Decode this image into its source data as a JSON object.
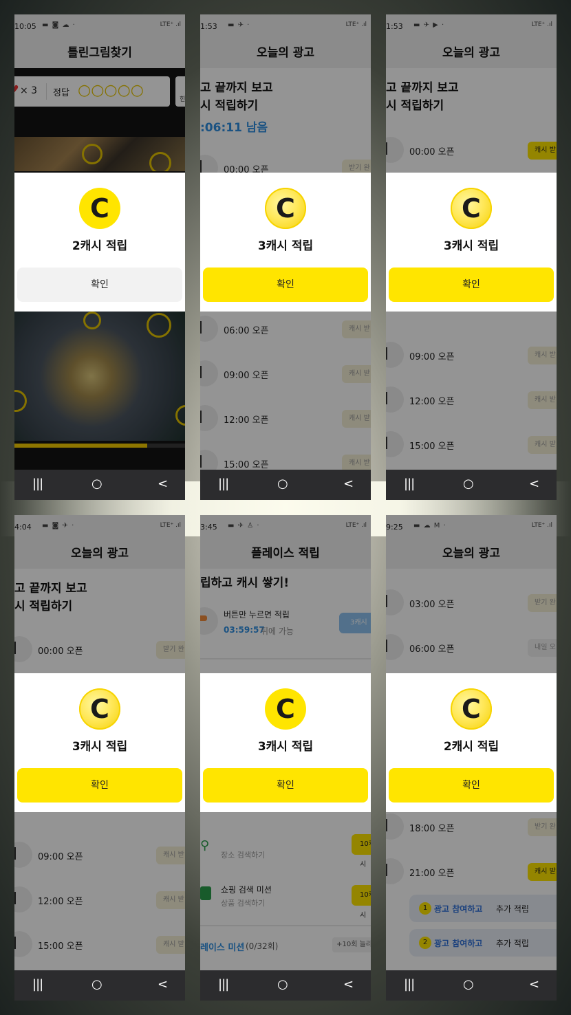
{
  "common": {
    "confirm_label": "확인",
    "nav": {
      "recent": "|||",
      "home": "○",
      "back": "<"
    },
    "coin_letter": "C",
    "open_suffix": "오픈"
  },
  "panels": [
    {
      "time": "10:05",
      "status_icons": "▬ ◙ ☁ ·",
      "network": "LTE⁺ .ıl",
      "title": "틀린그림찾기",
      "lives": "× 3",
      "answer_label": "정답",
      "hint": "힌",
      "reward_title": "2캐시 적립"
    },
    {
      "time": "1:53",
      "status_icons": "▬ ✈ ·",
      "network": "LTE⁺ .ıl",
      "title": "오늘의 광고",
      "headline1": "고 끝까지 보고",
      "headline2": "시 적립하기",
      "countdown": ":06:11 남음",
      "slots": [
        {
          "time": "00:00",
          "badge": "받기 완"
        },
        {
          "time": "06:00",
          "badge": "캐시 받"
        },
        {
          "time": "09:00",
          "badge": "캐시 받"
        },
        {
          "time": "12:00",
          "badge": "캐시 받"
        },
        {
          "time": "15:00",
          "badge": "캐시 받"
        }
      ],
      "reward_title": "3캐시 적립"
    },
    {
      "time": "1:53",
      "status_icons": "▬ ✈ ▶ ·",
      "network": "LTE⁺ .ıl",
      "title": "오늘의 광고",
      "headline1": "고 끝까지 보고",
      "headline2": "시 적립하기",
      "slots": [
        {
          "time": "00:00",
          "badge": "캐시 받"
        },
        {
          "time": "09:00",
          "badge": "캐시 받"
        },
        {
          "time": "12:00",
          "badge": "캐시 받"
        },
        {
          "time": "15:00",
          "badge": "캐시 받"
        }
      ],
      "reward_title": "3캐시 적립"
    },
    {
      "time": "4:04",
      "status_icons": "▬ ◙ ✈ ·",
      "network": "LTE⁺ .ıl",
      "title": "오늘의 광고",
      "headline1": "고 끝까지 보고",
      "headline2": "시 적립하기",
      "slots": [
        {
          "time": "00:00",
          "badge": "받기 완"
        },
        {
          "time": "09:00",
          "badge": "캐시 받"
        },
        {
          "time": "12:00",
          "badge": "캐시 받"
        },
        {
          "time": "15:00",
          "badge": "캐시 받"
        }
      ],
      "reward_title": "3캐시 적립"
    },
    {
      "time": "3:45",
      "status_icons": "▬ ✈ ♙ ·",
      "network": "LTE⁺ .ıl",
      "title": "플레이스 적립",
      "headline1": "립하고 캐시 쌓기!",
      "press_title": "버튼만 누르면 적립",
      "press_timer": "03:59:57",
      "press_suffix": " 뒤에 가능",
      "press_badge": "3캐시",
      "place_sub": "장소 검색하기",
      "place_badge": "10캐시",
      "shop_title": "쇼핑 검색 미션",
      "shop_sub": "상품 검색하기",
      "shop_badge": "10캐시",
      "mission_title": "레이스 미션",
      "mission_count": "(0/32회)",
      "mission_more": "+10회 늘리",
      "reward_title": "3캐시 적립"
    },
    {
      "time": "9:25",
      "status_icons": "▬ ☁ M ·",
      "network": "LTE⁺ .ıl",
      "title": "오늘의 광고",
      "slots_top": [
        {
          "time": "03:00",
          "badge": "받기 완"
        },
        {
          "time": "06:00",
          "badge": "내일 오"
        }
      ],
      "slots_bottom": [
        {
          "time": "18:00",
          "badge": "받기 완"
        },
        {
          "time": "21:00",
          "badge": "캐시 받"
        }
      ],
      "extras": [
        {
          "num": "1",
          "link": "광고 참여하고",
          "text": " 추가 적립"
        },
        {
          "num": "2",
          "link": "광고 참여하고",
          "text": " 추가 적립"
        }
      ],
      "reward_title": "2캐시 적립"
    }
  ]
}
